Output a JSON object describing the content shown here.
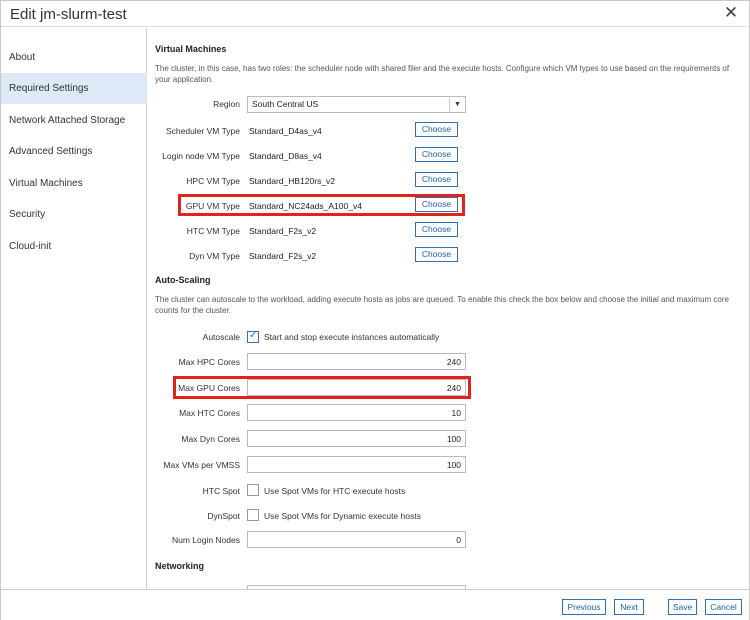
{
  "dialog": {
    "title": "Edit jm-slurm-test",
    "close_icon": "close-icon"
  },
  "sidebar": {
    "items": [
      {
        "label": "About"
      },
      {
        "label": "Required Settings",
        "active": true
      },
      {
        "label": "Network Attached Storage"
      },
      {
        "label": "Advanced Settings"
      },
      {
        "label": "Virtual Machines"
      },
      {
        "label": "Security"
      },
      {
        "label": "Cloud-init"
      }
    ]
  },
  "vm": {
    "title": "Virtual Machines",
    "description": "The cluster, in this case, has two roles: the scheduler node with shared filer and the execute hosts. Configure which VM types to use based on the requirements of your application.",
    "region": {
      "label": "Region",
      "value": "South Central US"
    },
    "choose_label": "Choose",
    "types": [
      {
        "label": "Scheduler VM Type",
        "value": "Standard_D4as_v4"
      },
      {
        "label": "Login node VM Type",
        "value": "Standard_D8as_v4"
      },
      {
        "label": "HPC VM Type",
        "value": "Standard_HB120rs_v2"
      },
      {
        "label": "GPU VM Type",
        "value": "Standard_NC24ads_A100_v4"
      },
      {
        "label": "HTC VM Type",
        "value": "Standard_F2s_v2"
      },
      {
        "label": "Dyn VM Type",
        "value": "Standard_F2s_v2"
      }
    ]
  },
  "autoscale": {
    "title": "Auto-Scaling",
    "description": "The cluster can autoscale to the workload, adding execute hosts as jobs are queued. To enable this check the box below and choose the initial and maximum core counts for the cluster.",
    "autoscale": {
      "label": "Autoscale",
      "checked": true,
      "text": "Start and stop execute instances automatically"
    },
    "max_hpc": {
      "label": "Max HPC Cores",
      "value": "240"
    },
    "max_gpu": {
      "label": "Max GPU Cores",
      "value": "240"
    },
    "max_htc": {
      "label": "Max HTC Cores",
      "value": "10"
    },
    "max_dyn": {
      "label": "Max Dyn Cores",
      "value": "100"
    },
    "max_vms": {
      "label": "Max VMs per VMSS",
      "value": "100"
    },
    "htc_spot": {
      "label": "HTC Spot",
      "checked": false,
      "text": "Use Spot VMs for HTC execute hosts"
    },
    "dyn_spot": {
      "label": "DynSpot",
      "checked": false,
      "text": "Use Spot VMs for Dynamic execute hosts"
    },
    "num_login": {
      "label": "Num Login Nodes",
      "value": "0"
    }
  },
  "networking": {
    "title": "Networking"
  },
  "footer": {
    "previous": "Previous",
    "next": "Next",
    "save": "Save",
    "cancel": "Cancel"
  },
  "colors": {
    "accent": "#2f6fb5",
    "highlight": "#e0241b",
    "active_nav": "#dde9f7"
  }
}
